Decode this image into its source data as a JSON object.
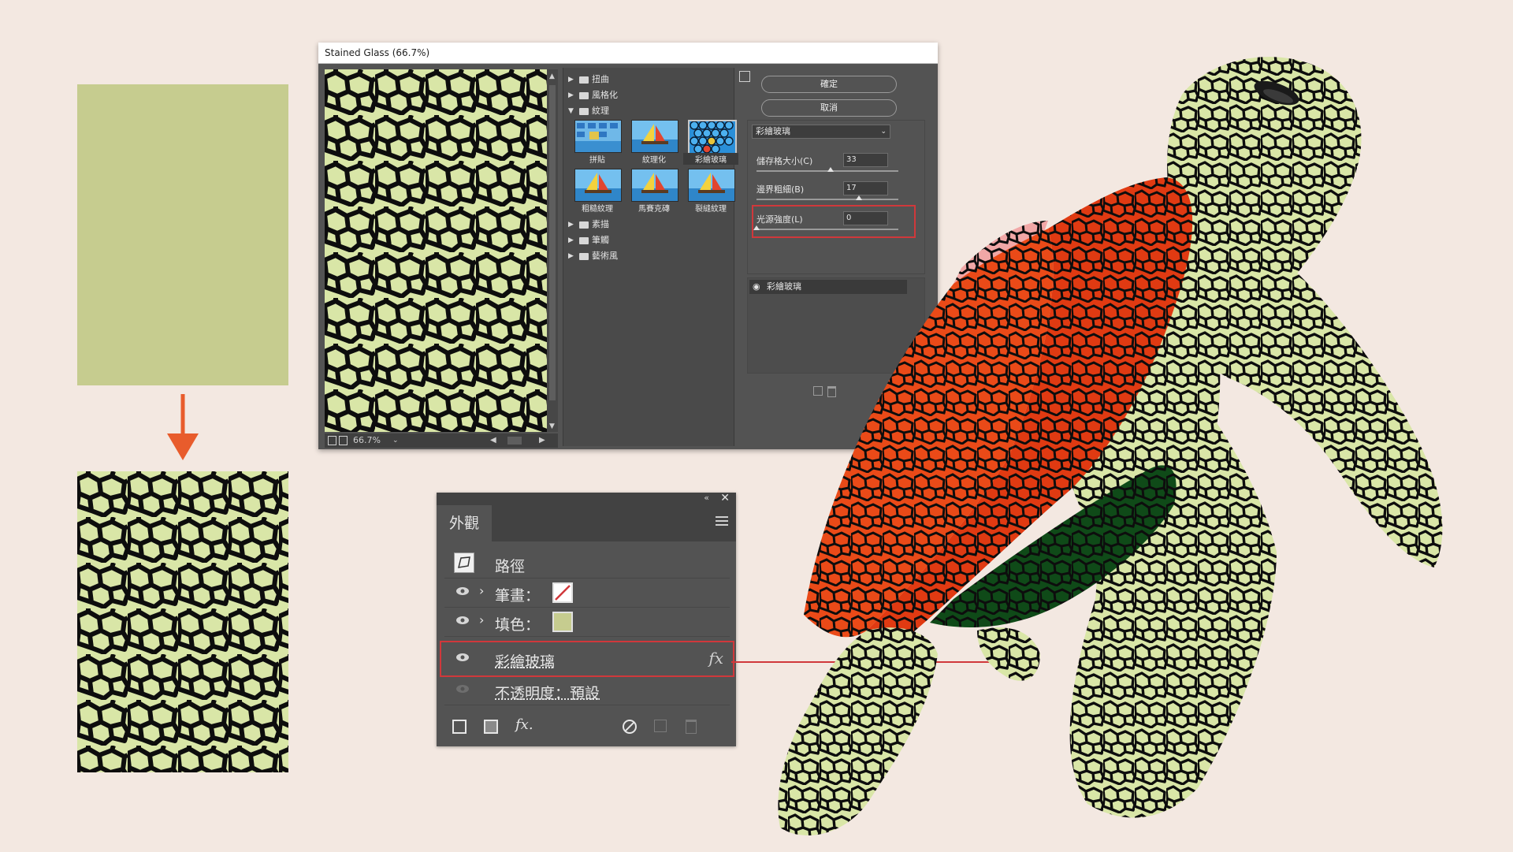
{
  "dialog": {
    "title": "Stained Glass (66.7%)",
    "zoom": "66.7%",
    "folders": [
      {
        "label": "扭曲",
        "expanded": false
      },
      {
        "label": "風格化",
        "expanded": false
      },
      {
        "label": "紋理",
        "expanded": true
      },
      {
        "label": "素描",
        "expanded": false
      },
      {
        "label": "筆觸",
        "expanded": false
      },
      {
        "label": "藝術風",
        "expanded": false
      }
    ],
    "texture_thumbs": [
      "拼貼",
      "紋理化",
      "彩繪玻璃",
      "粗糙紋理",
      "馬賽克磚",
      "裂縫紋理"
    ],
    "selected_thumb": "彩繪玻璃",
    "ok_label": "確定",
    "cancel_label": "取消",
    "filter_select": "彩繪玻璃",
    "params": [
      {
        "label": "儲存格大小(C)",
        "value": "33",
        "fraction": 0.5
      },
      {
        "label": "邊界粗細(B)",
        "value": "17",
        "fraction": 0.7
      },
      {
        "label": "光源強度(L)",
        "value": "0",
        "fraction": 0.0
      }
    ],
    "layer_item": "彩繪玻璃",
    "accent_highlight": "#d0383b"
  },
  "appearance": {
    "tab_label": "外觀",
    "path_label": "路徑",
    "stroke_label": "筆畫：",
    "fill_label": "填色：",
    "effect_label": "彩繪玻璃",
    "fx_symbol": "fx",
    "opacity_label": "不透明度：預設",
    "bottom_fx": "fx."
  },
  "colors": {
    "background": "#f3e8e1",
    "swatch_green": "#c6cc8f",
    "stained_fill": "#d9e6a7",
    "arrow_orange": "#e85c2c",
    "highlight_red": "#d0383b",
    "shell_orange": "#ea4a18",
    "shell_red": "#e03a12",
    "shell_dark_green": "#0f4a18",
    "shell_pink": "#f1a7a6"
  }
}
